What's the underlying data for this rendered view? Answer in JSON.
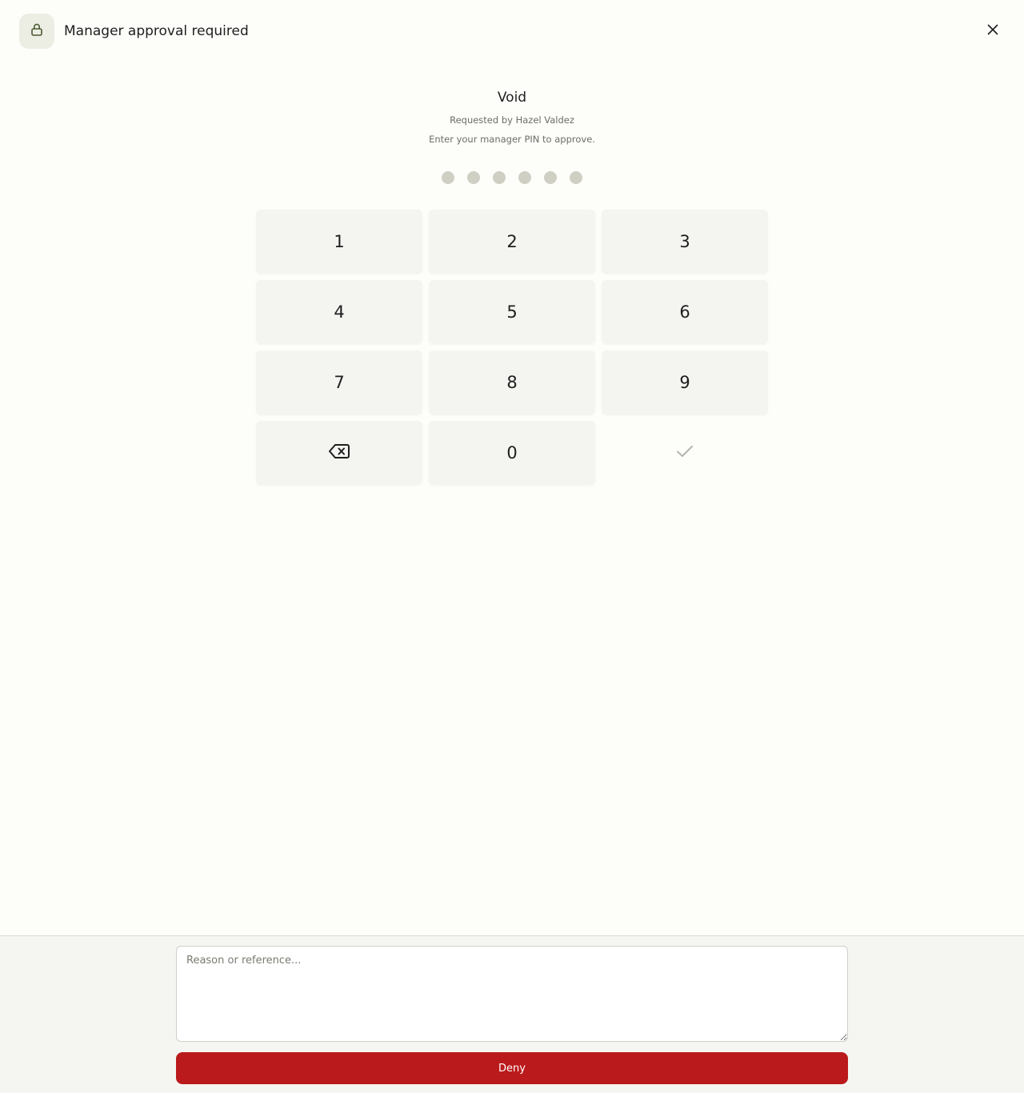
{
  "header": {
    "title": "Manager approval required",
    "lock_icon": "lock-icon",
    "close_icon": "close-icon"
  },
  "request": {
    "action": "Void",
    "requested_by": "Requested by Hazel Valdez",
    "instruction": "Enter your manager PIN to approve."
  },
  "pin": {
    "length": 6,
    "entered": 0
  },
  "keypad": {
    "keys": [
      "1",
      "2",
      "3",
      "4",
      "5",
      "6",
      "7",
      "8",
      "9"
    ],
    "zero": "0",
    "backspace_icon": "backspace-icon",
    "confirm_icon": "check-icon"
  },
  "footer": {
    "reason_placeholder": "Reason or reference...",
    "deny_label": "Deny"
  },
  "colors": {
    "background": "#fdfdfa",
    "deny": "#bb1a1c",
    "lock_badge": "#eceee4",
    "lock_icon": "#4a5a30",
    "pin_dot": "#cfcfc4",
    "key_background": "#f4f4f1"
  }
}
